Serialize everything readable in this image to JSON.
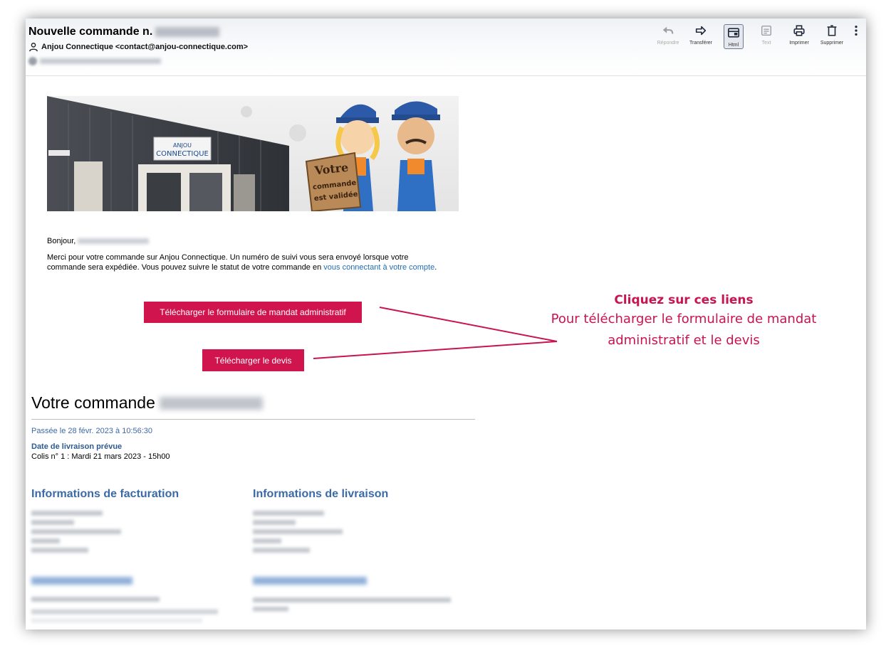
{
  "email": {
    "subject_prefix": "Nouvelle commande n.",
    "sender": "Anjou Connectique <contact@anjou-connectique.com>"
  },
  "toolbar": {
    "items": [
      {
        "label": "Répondre",
        "icon": "reply-icon",
        "state": "disabled"
      },
      {
        "label": "Transférer",
        "icon": "forward-icon",
        "state": "enabled"
      },
      {
        "label": "Html",
        "icon": "html-view-icon",
        "state": "active"
      },
      {
        "label": "Text",
        "icon": "text-view-icon",
        "state": "disabled"
      },
      {
        "label": "Imprimer",
        "icon": "print-icon",
        "state": "enabled"
      },
      {
        "label": "Supprimer",
        "icon": "trash-icon",
        "state": "enabled"
      }
    ],
    "more_icon": "more-vertical-icon"
  },
  "banner": {
    "sign_brand": "ANJOU CONNECTIQUE",
    "board_text": [
      "Votre",
      "commande",
      "est validée"
    ]
  },
  "body": {
    "greeting": "Bonjour,",
    "paragraph_text": "Merci pour votre commande sur Anjou Connectique. Un numéro de suivi vous sera envoyé lorsque votre commande sera expédiée. Vous pouvez suivre le statut de votre commande en ",
    "paragraph_link": "vous connectant à votre compte",
    "paragraph_end": ".",
    "button_mandat": "Télécharger le formulaire de mandat administratif",
    "button_devis": "Télécharger le devis"
  },
  "order": {
    "title_prefix": "Votre commande",
    "placed": "Passée le 28 févr. 2023 à 10:56:30",
    "delivery_label": "Date de livraison prévue",
    "delivery_value": "Colis n° 1 : Mardi 21 mars 2023 - 15h00",
    "billing_title": "Informations de facturation",
    "shipping_title": "Informations de livraison"
  },
  "annotation": {
    "title": "Cliquez sur ces liens",
    "body": "Pour télécharger le formulaire de mandat administratif et le devis",
    "color": "#c81450"
  },
  "colors": {
    "button": "#d0144e",
    "section_title": "#3a6aa8",
    "link": "#1e6db5"
  }
}
